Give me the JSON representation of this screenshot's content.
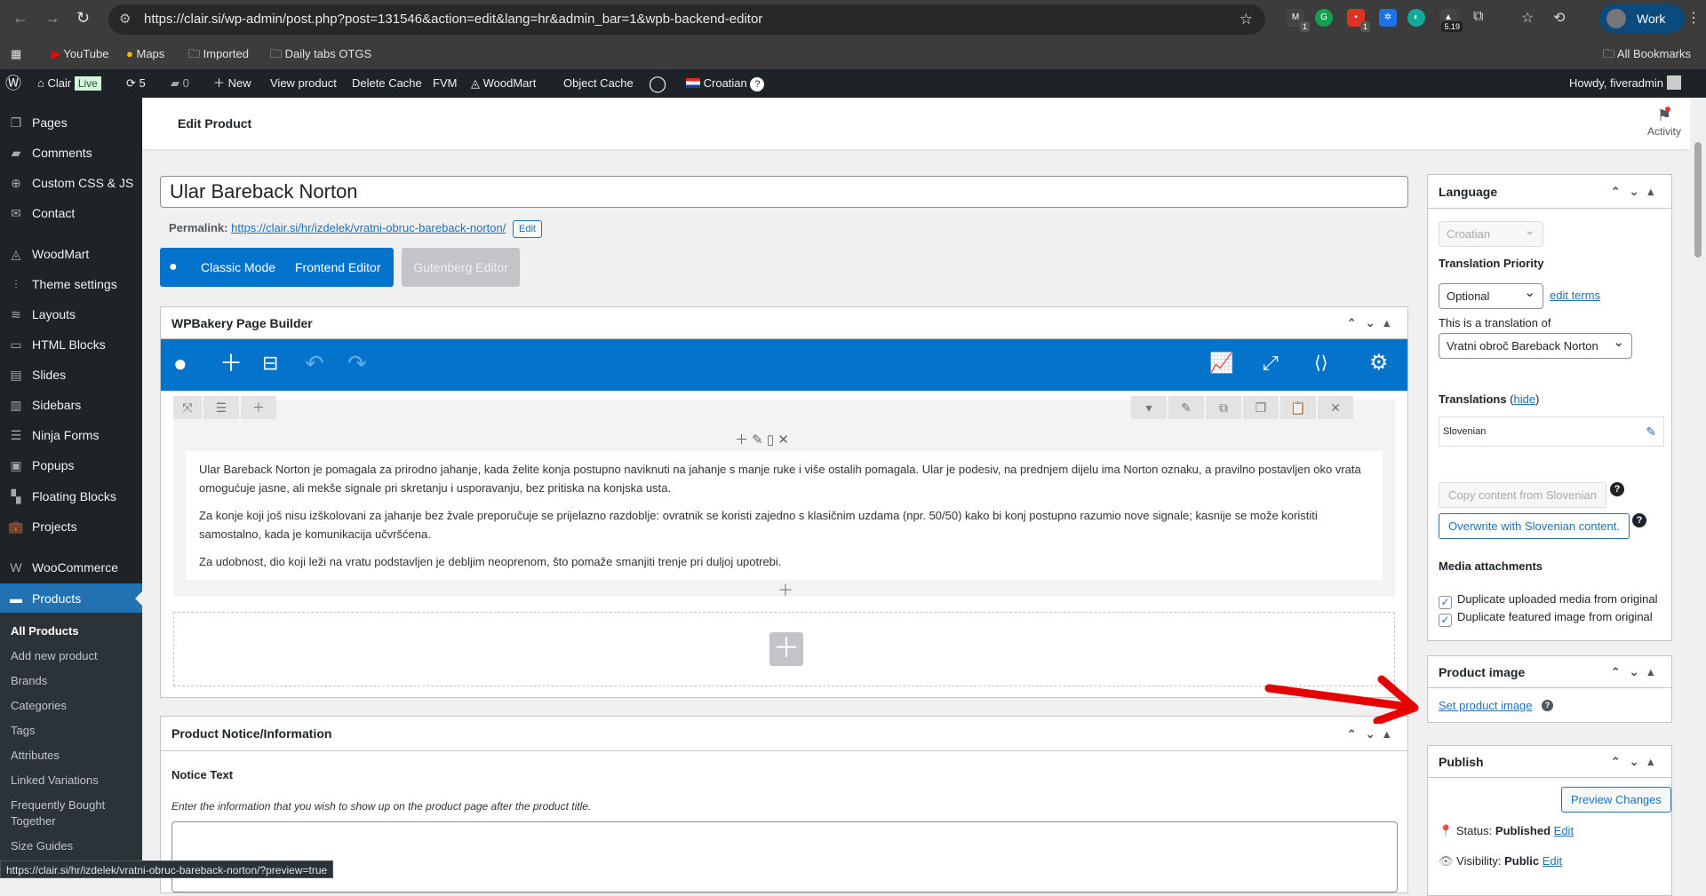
{
  "browser": {
    "url": "https://clair.si/wp-admin/post.php?post=131546&action=edit&lang=hr&admin_bar=1&wpb-backend-editor",
    "profile": "Work",
    "ext_badges": [
      "1",
      "1",
      "5.19"
    ],
    "bookmarks": [
      "YouTube",
      "Maps",
      "Imported",
      "Daily tabs OTGS"
    ],
    "all_bookmarks": "All Bookmarks"
  },
  "adminbar": {
    "site": "Clair",
    "live": "Live",
    "updates": "5",
    "comments": "0",
    "new": "New",
    "items": [
      "View product",
      "Delete Cache",
      "FVM",
      "WoodMart",
      "Object Cache"
    ],
    "language": "Croatian",
    "help": "?",
    "howdy": "Howdy, fiveradmin"
  },
  "sidebar": {
    "items": [
      "Pages",
      "Comments",
      "Custom CSS & JS",
      "Contact",
      "WoodMart",
      "Theme settings",
      "Layouts",
      "HTML Blocks",
      "Slides",
      "Sidebars",
      "Ninja Forms",
      "Popups",
      "Floating Blocks",
      "Projects",
      "WooCommerce",
      "Products"
    ],
    "submenu": [
      "All Products",
      "Add new product",
      "Brands",
      "Categories",
      "Tags",
      "Attributes",
      "Linked Variations",
      "Frequently Bought Together",
      "Size Guides"
    ]
  },
  "header": {
    "title": "Edit Product",
    "activity": "Activity"
  },
  "post": {
    "title": "Ular Bareback Norton",
    "permalink_label": "Permalink:",
    "permalink": "https://clair.si/hr/izdelek/vratni-obruc-bareback-norton/",
    "edit": "Edit"
  },
  "modes": {
    "classic": "Classic Mode",
    "frontend": "Frontend Editor",
    "gutenberg": "Gutenberg Editor"
  },
  "wpb": {
    "title": "WPBakery Page Builder",
    "paragraphs": [
      "Ular Bareback Norton je pomagala za prirodno jahanje, kada želite konja postupno naviknuti na jahanje s manje ruke i više ostalih pomagala. Ular je podesiv, na prednjem dijelu ima Norton oznaku, a pravilno postavljen oko vrata omogućuje jasne, ali mekše signale pri skretanju i usporavanju, bez pritiska na konjska usta.",
      "Za konje koji još nisu izškolovani za jahanje bez žvale preporučuje se prijelazno razdoblje: ovratnik se koristi zajedno s klasičnim uzdama (npr. 50/50) kako bi konj postupno razumio nove signale; kasnije se može koristiti samostalno, kada je komunikacija učvršćena.",
      "Za udobnost, dio koji leži na vratu podstavljen je debljim neoprenom, što pomaže smanjiti trenje pri duljoj upotrebi."
    ]
  },
  "notice": {
    "title": "Product Notice/Information",
    "label": "Notice Text",
    "desc": "Enter the information that you wish to show up on the product page after the product title."
  },
  "language_box": {
    "title": "Language",
    "language": "Croatian",
    "priority_label": "Translation Priority",
    "priority": "Optional",
    "edit_terms": "edit terms",
    "translation_of_label": "This is a translation of",
    "translation_of": "Vratni obroč Bareback Norton",
    "translations_label": "Translations",
    "hide": "hide",
    "translation": "Slovenian",
    "copy_btn": "Copy content from Slovenian",
    "overwrite_btn": "Overwrite with Slovenian content.",
    "media_label": "Media attachments",
    "cb1": "Duplicate uploaded media from original",
    "cb2": "Duplicate featured image from original"
  },
  "product_image": {
    "title": "Product image",
    "link": "Set product image"
  },
  "publish": {
    "title": "Publish",
    "preview": "Preview Changes",
    "status_label": "Status:",
    "status": "Published",
    "visibility_label": "Visibility:",
    "visibility": "Public",
    "edit": "Edit"
  },
  "statusbar": "https://clair.si/hr/izdelek/vratni-obruc-bareback-norton/?preview=true",
  "colors": {
    "wp_blue": "#2271b1",
    "wpb_blue": "#0473cc",
    "annotation_arrow": "#e60000"
  }
}
